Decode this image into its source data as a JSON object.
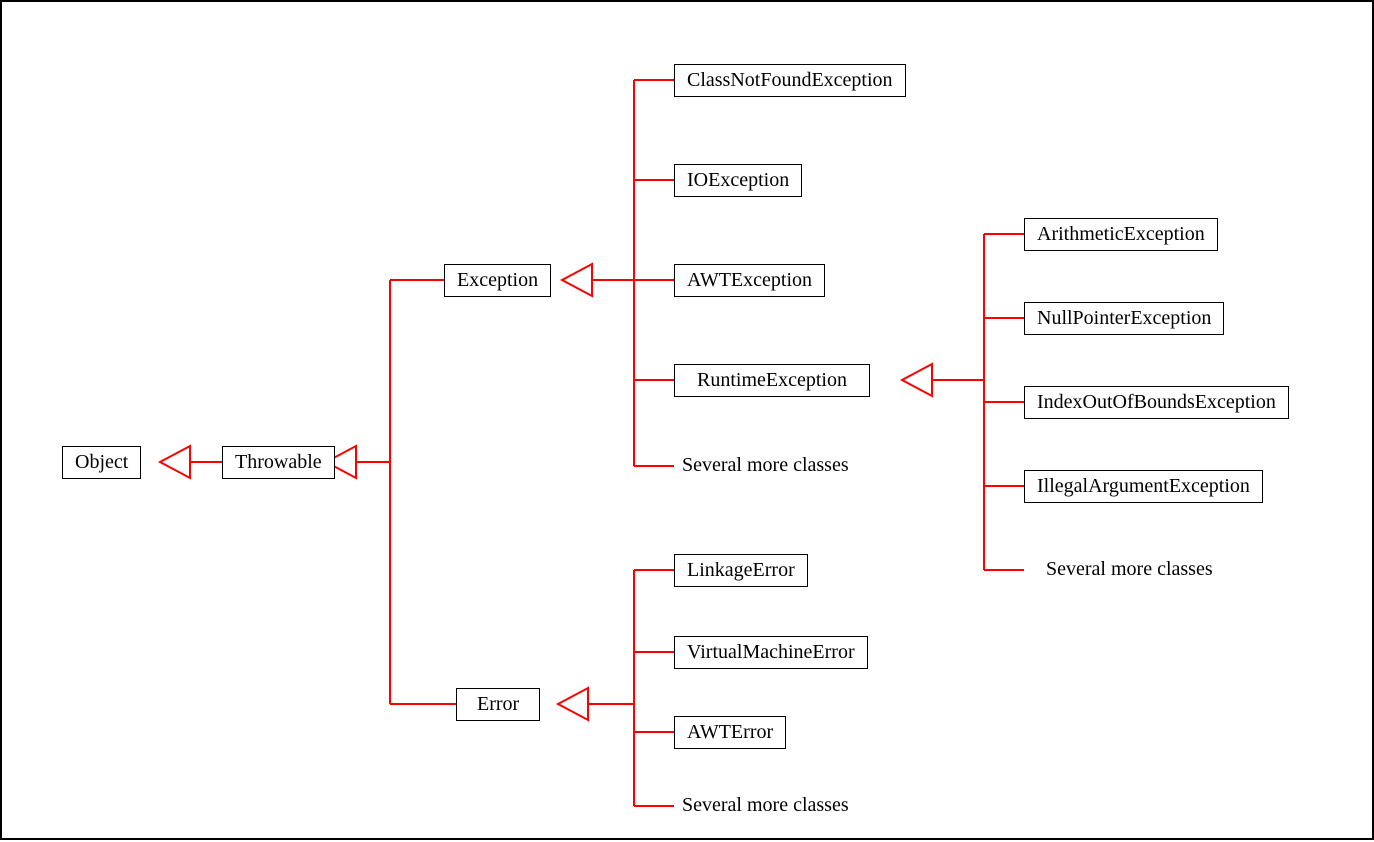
{
  "nodes": {
    "object": "Object",
    "throwable": "Throwable",
    "exception": "Exception",
    "error": "Error",
    "classNotFoundException": "ClassNotFoundException",
    "ioException": "IOException",
    "awtException": "AWTException",
    "runtimeException": "RuntimeException",
    "arithmeticException": "ArithmeticException",
    "nullPointerException": "NullPointerException",
    "indexOutOfBoundsException": "IndexOutOfBoundsException",
    "illegalArgumentException": "IllegalArgumentException",
    "linkageError": "LinkageError",
    "virtualMachineError": "VirtualMachineError",
    "awtError": "AWTError"
  },
  "labels": {
    "severalMore": "Several more classes"
  },
  "colors": {
    "connector": "#ff0000",
    "border": "#000000",
    "background": "#ffffff"
  }
}
